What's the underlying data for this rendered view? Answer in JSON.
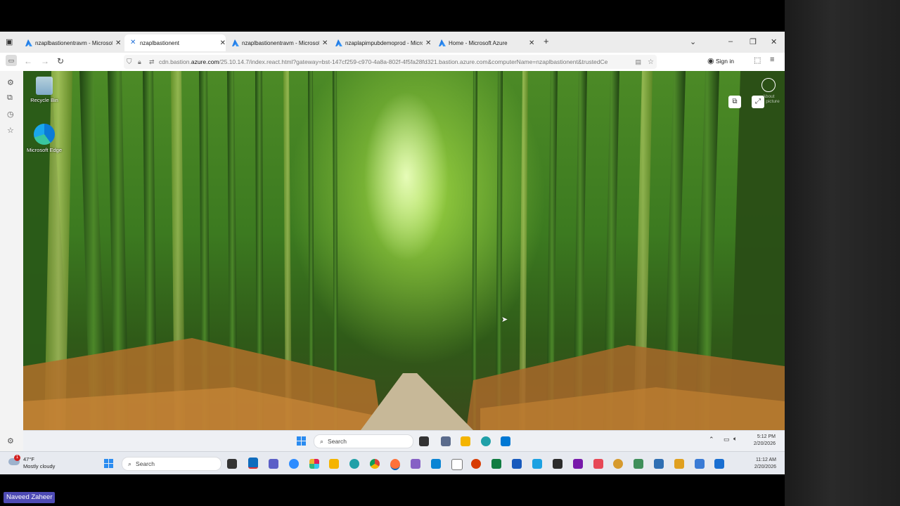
{
  "browser": {
    "tabs": [
      {
        "label": "nzaplbastionentravm - Microsoft Azure",
        "icon": "azure-icon",
        "active": false
      },
      {
        "label": "nzaplbastionent",
        "icon": "bastion-icon",
        "active": true
      },
      {
        "label": "nzaplbastionentravm - Microsoft Azure",
        "icon": "azure-icon",
        "active": false
      },
      {
        "label": "nzaplapimpubdemoprod - Microsoft Azure",
        "icon": "azure-icon",
        "active": false
      },
      {
        "label": "Home - Microsoft Azure",
        "icon": "azure-icon",
        "active": false
      }
    ],
    "new_tab_symbol": "+",
    "url_prefix": "cdn.bastion.",
    "url_domain": "azure.com",
    "url_rest": "/25.10.14.7/index.react.html?gateway=bst-147cf259-c970-4a8a-802f-4f5fa28fd321.bastion.azure.com&computerName=nzaplbastionent&trustedCe",
    "signin_label": "Sign in"
  },
  "remote_desktop": {
    "icons": [
      {
        "label": "Recycle Bin",
        "icon": "recycle-bin-icon"
      },
      {
        "label": "Microsoft Edge",
        "icon": "edge-icon"
      }
    ],
    "about_label": "About\nthis picture",
    "taskbar": {
      "search_placeholder": "Search",
      "time": "5:12 PM",
      "date": "2/20/2026"
    }
  },
  "local_taskbar": {
    "weather_temp": "47°F",
    "weather_desc": "Mostly cloudy",
    "weather_badge": "1",
    "search_placeholder": "Search",
    "time": "11:12 AM",
    "date": "2/20/2026"
  },
  "presenter_name": "Naveed Zaheer",
  "colors": {
    "accent": "#2b8cf0",
    "name_badge": "#4e4bb5"
  }
}
